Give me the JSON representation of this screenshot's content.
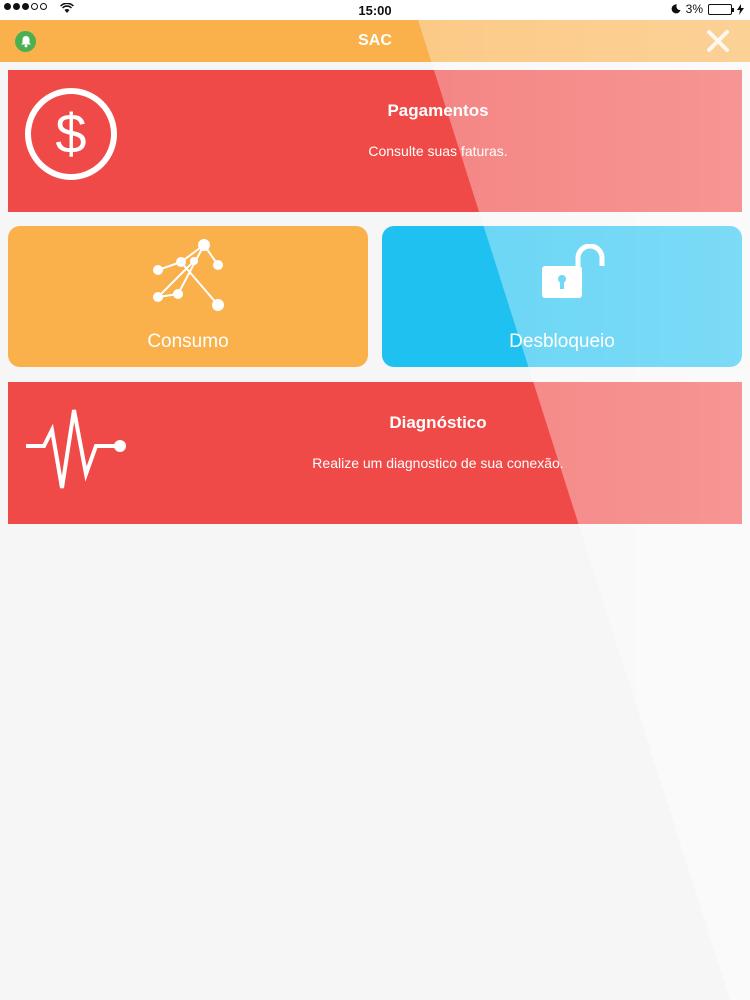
{
  "status_bar": {
    "time": "15:00",
    "battery_percent": "3%"
  },
  "header": {
    "title": "SAC",
    "left_icon": "bell-icon",
    "right_icon": "close-icon"
  },
  "tiles": {
    "pagamentos": {
      "title": "Pagamentos",
      "subtitle": "Consulte suas faturas.",
      "icon": "dollar-icon"
    },
    "consumo": {
      "label": "Consumo",
      "icon": "network-graph-icon"
    },
    "desbloqueio": {
      "label": "Desbloqueio",
      "icon": "unlock-icon"
    },
    "diagnostico": {
      "title": "Diagnóstico",
      "subtitle": "Realize um diagnostico de sua conexão.",
      "icon": "pulse-icon"
    }
  },
  "colors": {
    "header": "#fab04b",
    "red_tile": "#ef4a47",
    "orange_tile": "#fab04b",
    "blue_tile": "#1ec1f0",
    "bell": "#4caf50"
  }
}
